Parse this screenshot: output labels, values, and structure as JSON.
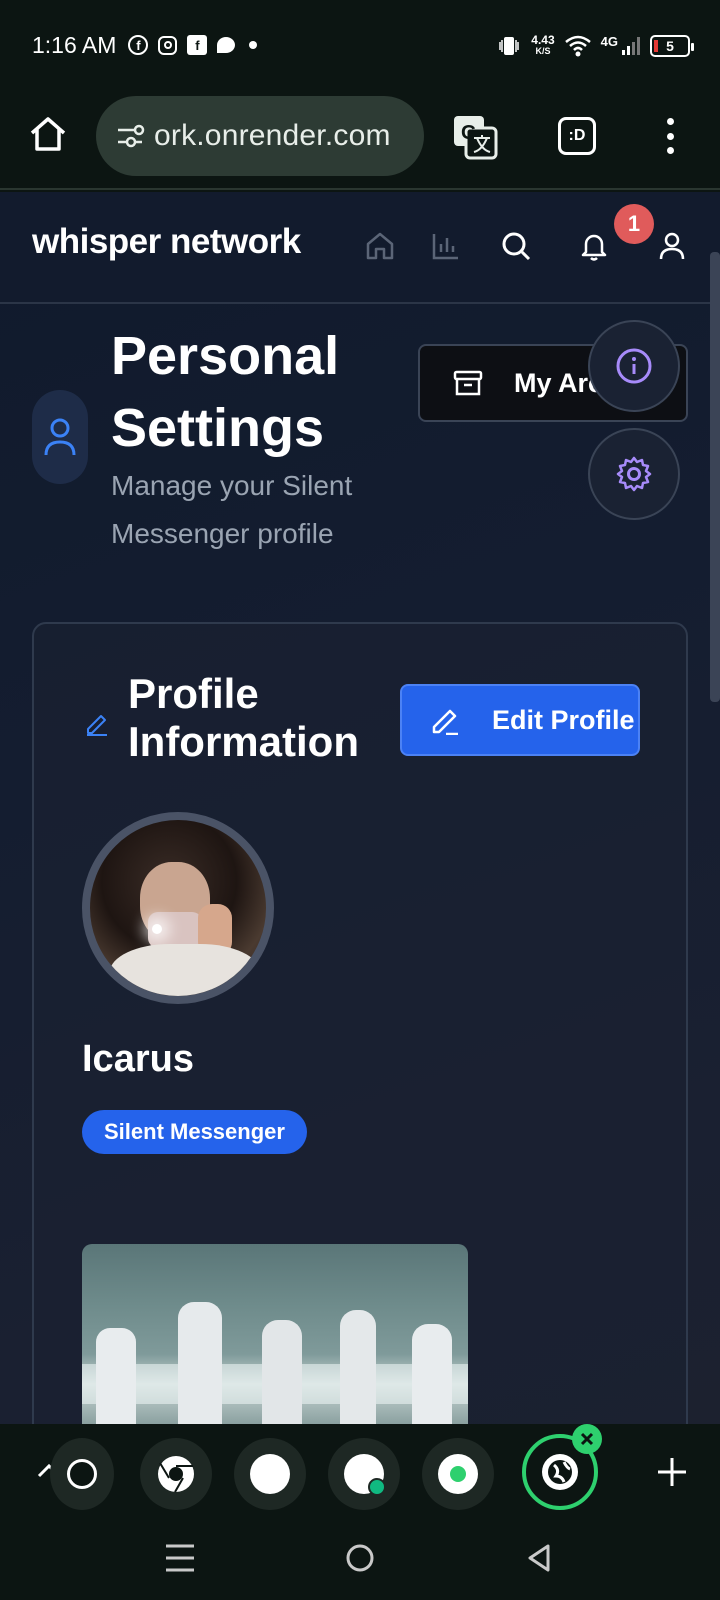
{
  "status_bar": {
    "time": "1:16 AM",
    "speed_value": "4.43",
    "speed_unit": "K/S",
    "network": "4G",
    "battery": "5"
  },
  "browser": {
    "url": "ork.onrender.com",
    "tab_count_label": ":D"
  },
  "app": {
    "brand": "whisper network",
    "notification_count": "1",
    "page_title": "Personal Settings",
    "page_subtitle": "Manage your Silent Messenger profile",
    "archive_label": "My Archive",
    "card_title": "Profile Information",
    "edit_profile_label": "Edit Profile",
    "username": "Icarus",
    "role": "Silent Messenger"
  },
  "colors": {
    "accent_blue": "#2563eb",
    "notification_red": "#e05b5b",
    "fab_purple": "#a78bfa",
    "active_tab_green": "#2ed06e"
  }
}
